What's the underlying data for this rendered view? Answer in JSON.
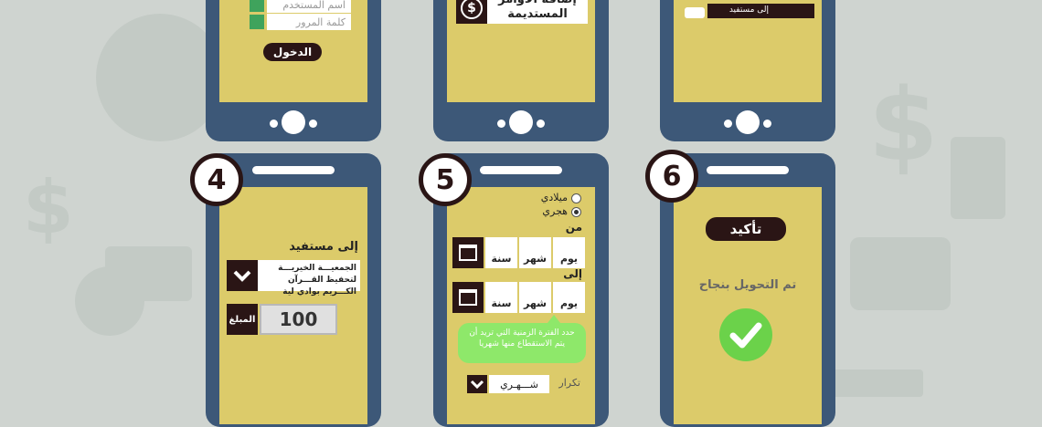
{
  "phone1": {
    "username_placeholder": "اسم المستخدم",
    "password_placeholder": "كلمة المرور",
    "login_label": "الدخول"
  },
  "phone2": {
    "standing_orders_label": "إضافة الأوامر المستديمة"
  },
  "phone3": {
    "to_beneficiary_label": "إلى مستفيد"
  },
  "step4": {
    "number": "4",
    "to_beneficiary": "إلى مستفيد",
    "beneficiary_value": "الجمعيـــة الخيريـــة لتحفيظ القـــرآن الكـــريم بوادي لية",
    "amount_label": "المبلغ",
    "amount_value": "100"
  },
  "step5": {
    "number": "5",
    "gregorian": "ميلادي",
    "hijri": "هجري",
    "from_label": "من",
    "to_label": "إلى",
    "day": "يوم",
    "month": "شهر",
    "year": "سنة",
    "tooltip": "حدد الفترة الزمنية التي تريد أن يتم الاستقطاع منها شهريا",
    "repeat_label": "تكرار",
    "repeat_value": "شـــهـري"
  },
  "step6": {
    "number": "6",
    "confirm_label": "تأكيد",
    "success_text": "تم التحويل بنجاح"
  },
  "colors": {
    "phone_frame": "#3d5878",
    "screen": "#dccb6a",
    "dark": "#2a1515",
    "success": "#6bd24a",
    "tooltip": "#8ee86a"
  }
}
